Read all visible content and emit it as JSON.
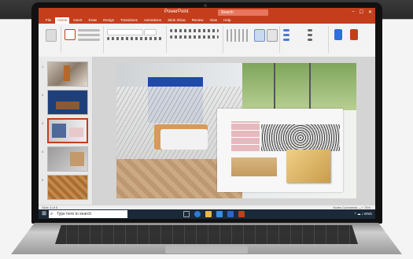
{
  "app": {
    "title": "PowerPoint",
    "search_placeholder": "Search",
    "window_controls": [
      "–",
      "☐",
      "✕"
    ]
  },
  "menu": {
    "tabs": [
      "File",
      "Home",
      "Insert",
      "Draw",
      "Design",
      "Transitions",
      "Animations",
      "Slide Show",
      "Review",
      "View",
      "Help"
    ],
    "active_index": 1
  },
  "slides": {
    "numbers": [
      "1",
      "2",
      "3",
      "4",
      "5"
    ],
    "selected_index": 2
  },
  "statusbar": {
    "left": "Slide 3 of 5",
    "right": "Notes   Comments   —+  75%"
  },
  "taskbar": {
    "search_placeholder": "Type here to search",
    "start_icon": "windows-icon",
    "tray": "^ ☁ ♪ ENG"
  },
  "colors": {
    "accent": "#c43e1c",
    "taskbar": "#1b2a3a"
  }
}
